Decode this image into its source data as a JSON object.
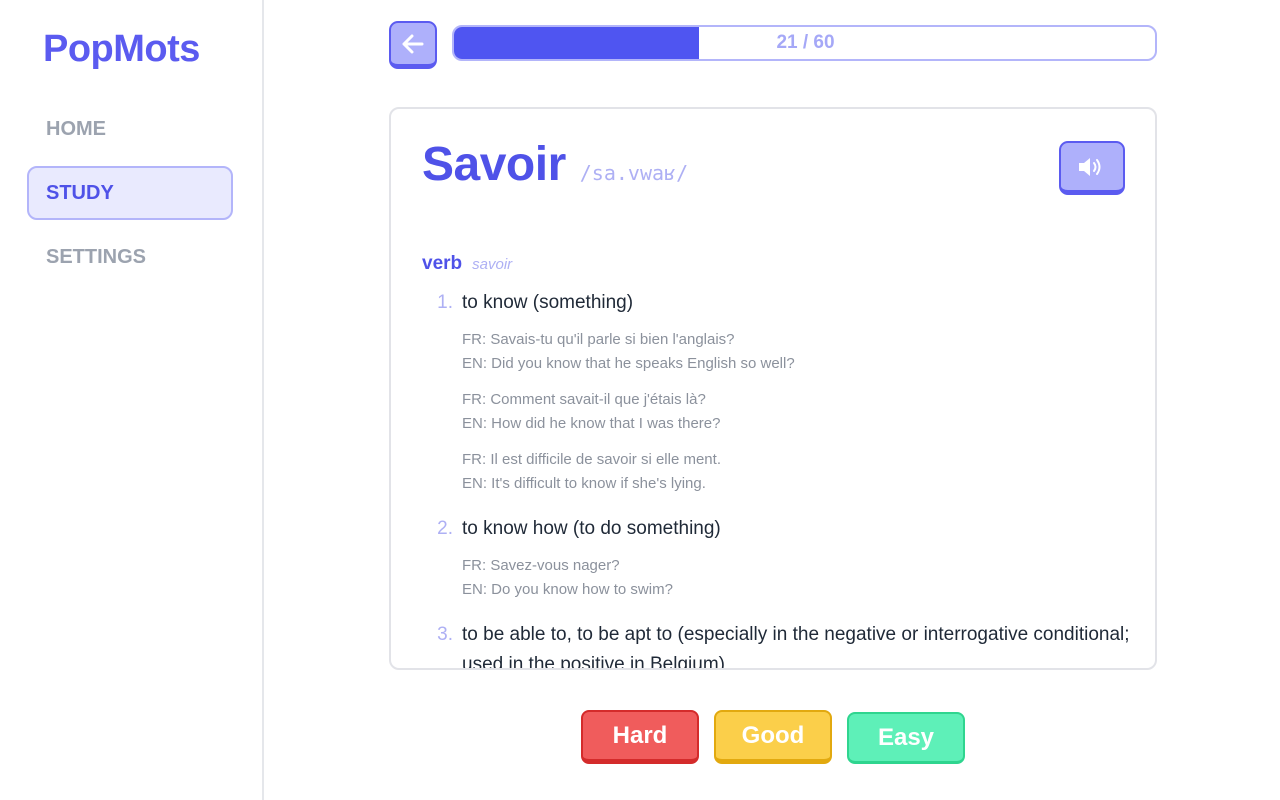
{
  "app": {
    "name": "PopMots"
  },
  "nav": {
    "items": [
      {
        "label": "HOME",
        "active": false
      },
      {
        "label": "STUDY",
        "active": true
      },
      {
        "label": "SETTINGS",
        "active": false
      }
    ]
  },
  "progress": {
    "text": "21 / 60",
    "current": 21,
    "total": 60,
    "fill_fraction": 0.35
  },
  "card": {
    "word": "Savoir",
    "ipa": "/sa.vwaʁ/",
    "part_of_speech": "verb",
    "lemma": "savoir",
    "senses": [
      {
        "num": "1.",
        "text": "to know (something)",
        "examples": [
          {
            "fr": "FR: Savais-tu qu'il parle si bien l'anglais?",
            "en": "EN: Did you know that he speaks English so well?"
          },
          {
            "fr": "FR: Comment savait-il que j'étais là?",
            "en": "EN: How did he know that I was there?"
          },
          {
            "fr": "FR: Il est difficile de savoir si elle ment.",
            "en": "EN: It's difficult to know if she's lying."
          }
        ]
      },
      {
        "num": "2.",
        "text": "to know how (to do something)",
        "examples": [
          {
            "fr": "FR: Savez-vous nager?",
            "en": "EN: Do you know how to swim?"
          }
        ]
      },
      {
        "num": "3.",
        "text": "to be able to, to be apt to (especially in the negative or interrogative conditional; used in the positive in Belgium)",
        "examples": []
      }
    ]
  },
  "ratings": {
    "hard": "Hard",
    "good": "Good",
    "easy": "Easy"
  },
  "icons": {
    "back": "arrow-left-icon",
    "audio": "speaker-icon"
  },
  "colors": {
    "accent": "#4f52e8",
    "hard": "#f05c5c",
    "good": "#fbcf4a",
    "easy": "#5ef0b8"
  }
}
